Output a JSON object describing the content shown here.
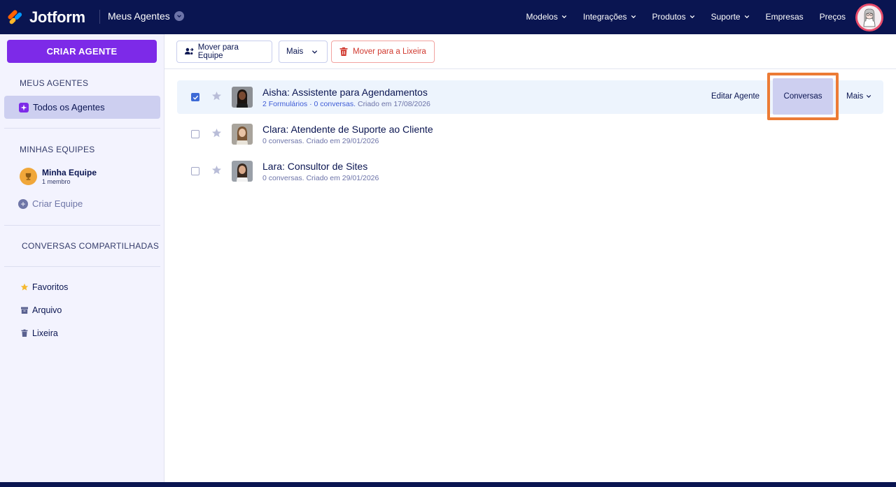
{
  "header": {
    "brand": "Jotform",
    "context": "Meus Agentes",
    "nav": [
      {
        "label": "Modelos",
        "dropdown": true
      },
      {
        "label": "Integrações",
        "dropdown": true
      },
      {
        "label": "Produtos",
        "dropdown": true
      },
      {
        "label": "Suporte",
        "dropdown": true
      },
      {
        "label": "Empresas",
        "dropdown": false
      },
      {
        "label": "Preços",
        "dropdown": false
      }
    ]
  },
  "sidebar": {
    "create_label": "CRIAR AGENTE",
    "my_agents_title": "MEUS AGENTES",
    "all_agents_label": "Todos os Agentes",
    "teams_title": "MINHAS EQUIPES",
    "team": {
      "name": "Minha Equipe",
      "members": "1 membro"
    },
    "create_team_label": "Criar Equipe",
    "shared_title": "CONVERSAS COMPARTILHADAS",
    "links": [
      {
        "label": "Favoritos",
        "icon": "star-icon"
      },
      {
        "label": "Arquivo",
        "icon": "archive-icon"
      },
      {
        "label": "Lixeira",
        "icon": "trash-icon"
      }
    ]
  },
  "toolbar": {
    "move_team_label": "Mover para Equipe",
    "more_label": "Mais",
    "trash_label": "Mover para a Lixeira"
  },
  "agents": [
    {
      "name": "Aisha: Assistente para Agendamentos",
      "forms": "2 Formulários",
      "sep": " · ",
      "conversations": "0 conversas.",
      "created": " Criado em 17/08/2026",
      "selected": true,
      "edit_label": "Editar Agente",
      "conversations_label": "Conversas",
      "more_label": "Mais"
    },
    {
      "name": "Clara: Atendente de Suporte ao Cliente",
      "meta": "0 conversas. Criado em 29/01/2026",
      "selected": false
    },
    {
      "name": "Lara: Consultor de Sites",
      "meta": "0 conversas. Criado em 29/01/2026",
      "selected": false
    }
  ],
  "colors": {
    "navy": "#0a1551",
    "purple": "#7d2ae8",
    "highlight": "#ec7b35",
    "selected_row": "#edf4fd",
    "trash_red": "#d0392f"
  }
}
